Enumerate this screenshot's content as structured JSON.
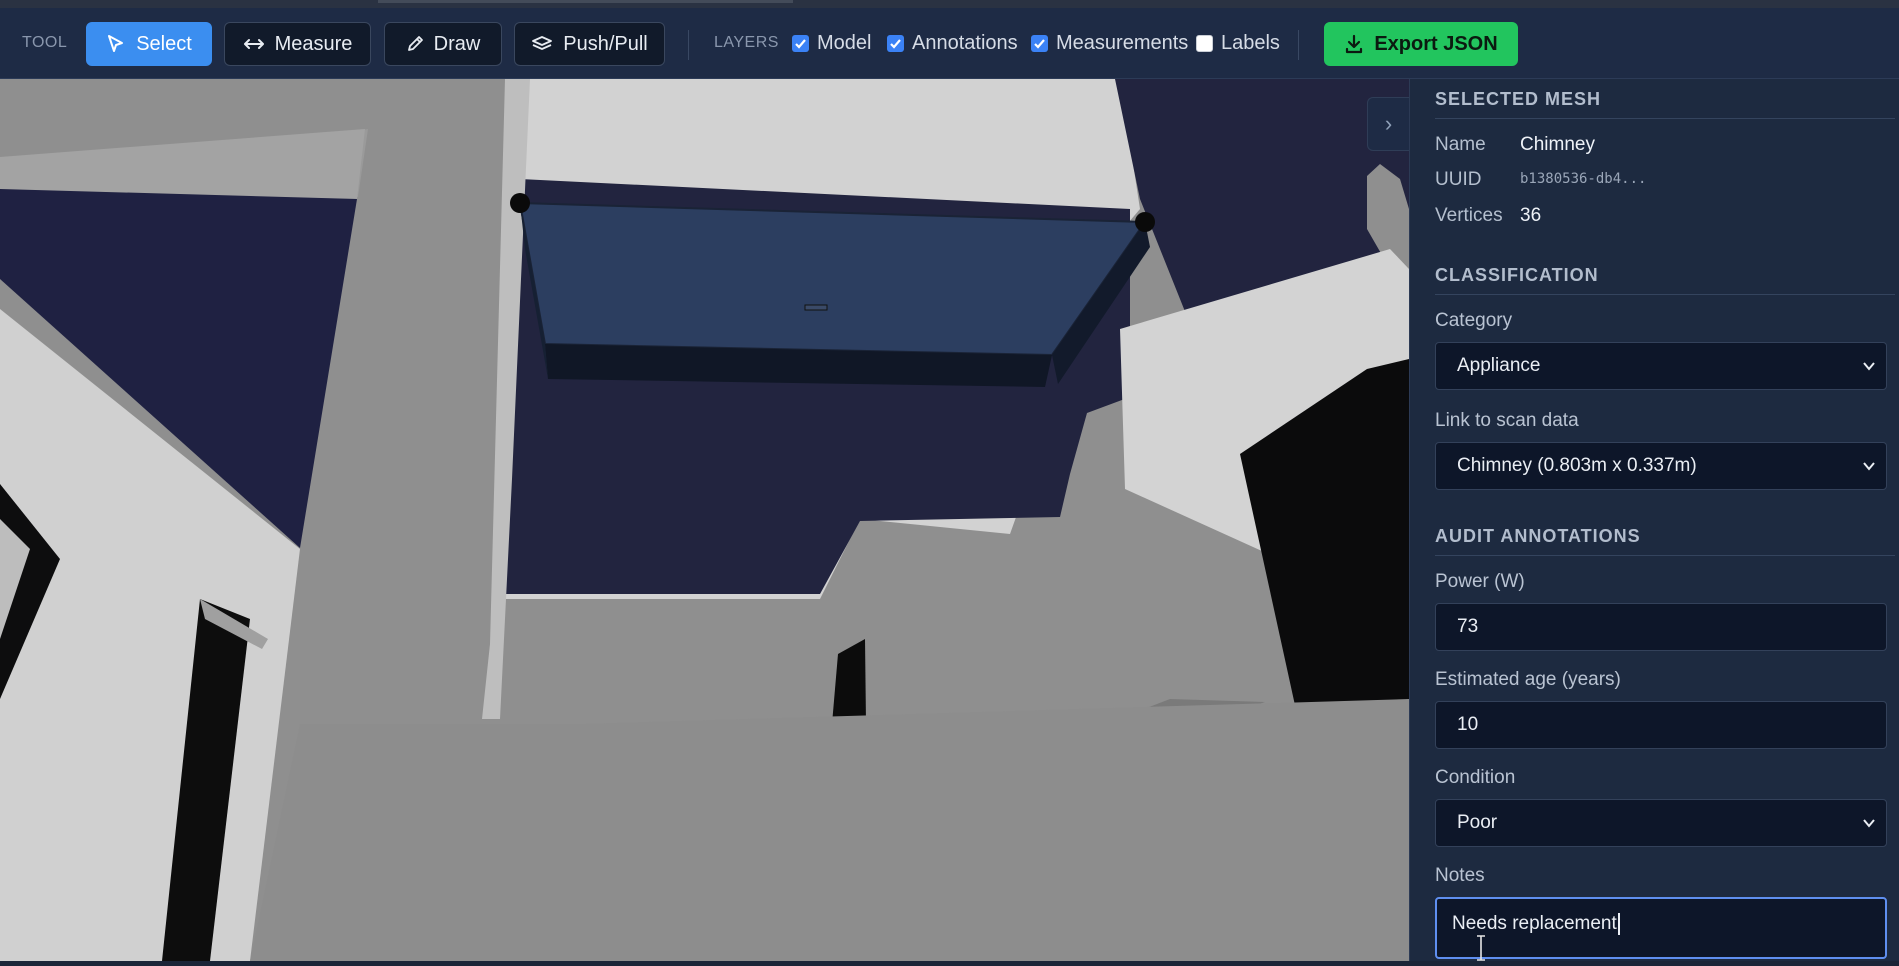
{
  "toolbar": {
    "tool_label": "TOOL",
    "tools": [
      {
        "label": "Select",
        "active": true
      },
      {
        "label": "Measure",
        "active": false
      },
      {
        "label": "Draw",
        "active": false
      },
      {
        "label": "Push/Pull",
        "active": false
      }
    ],
    "layers_label": "LAYERS",
    "layers": [
      {
        "label": "Model",
        "checked": true
      },
      {
        "label": "Annotations",
        "checked": true
      },
      {
        "label": "Measurements",
        "checked": true
      },
      {
        "label": "Labels",
        "checked": false
      }
    ],
    "export_label": "Export JSON"
  },
  "panel": {
    "collapse_glyph": "›",
    "selected_mesh": {
      "title": "SELECTED MESH",
      "name_key": "Name",
      "name_value": "Chimney",
      "uuid_key": "UUID",
      "uuid_value": "b1380536-db4...",
      "vertices_key": "Vertices",
      "vertices_value": "36"
    },
    "classification": {
      "title": "CLASSIFICATION",
      "category_label": "Category",
      "category_value": "Appliance",
      "link_label": "Link to scan data",
      "link_value": "Chimney (0.803m x 0.337m)"
    },
    "audit": {
      "title": "AUDIT ANNOTATIONS",
      "power_label": "Power (W)",
      "power_value": "73",
      "age_label": "Estimated age (years)",
      "age_value": "10",
      "condition_label": "Condition",
      "condition_value": "Poor",
      "notes_label": "Notes",
      "notes_value": "Needs replacement"
    }
  },
  "colors": {
    "toolbar_bg": "#1e2b45",
    "accent": "#3b8ef0",
    "export_green": "#22c55e",
    "panel_bg": "#1d2a40",
    "selection_fill": "#243350"
  }
}
